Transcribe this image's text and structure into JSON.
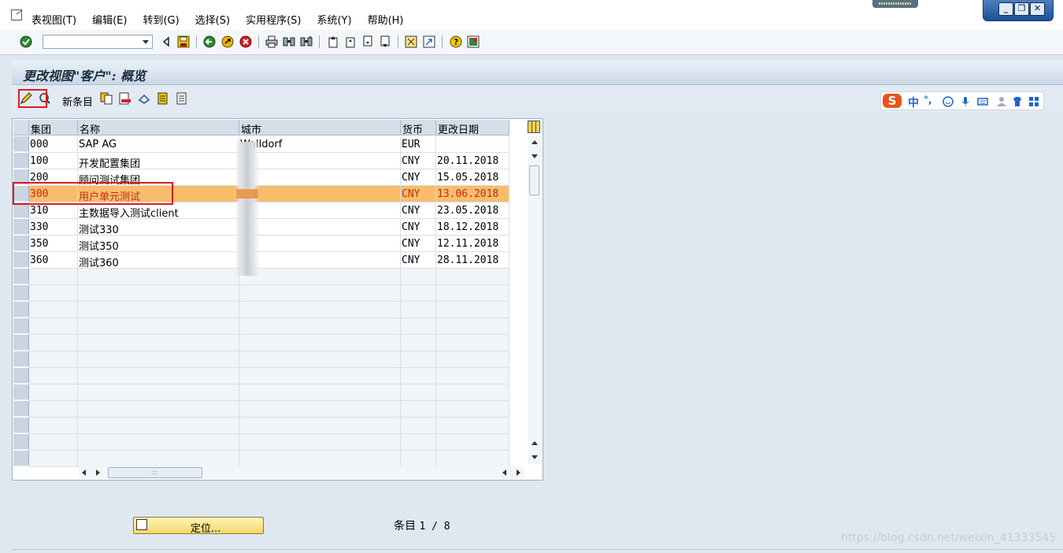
{
  "menu": {
    "items": [
      "表视图(T)",
      "编辑(E)",
      "转到(G)",
      "选择(S)",
      "实用程序(S)",
      "系统(Y)",
      "帮助(H)"
    ]
  },
  "toolbar": {
    "command_value": "",
    "icons": [
      "enter-icon",
      "save-icon",
      "back-icon",
      "exit-icon",
      "cancel-icon",
      "print-icon",
      "find-icon",
      "find-next-icon",
      "first-page-icon",
      "previous-page-icon",
      "next-page-icon",
      "last-page-icon",
      "create-session-icon",
      "shortcut-icon",
      "help-icon",
      "layout-icon"
    ]
  },
  "title": "更改视图\"客户\": 概览",
  "app_toolbar": {
    "new_entries": "新条目",
    "icons": [
      "display-change-icon",
      "other-view-icon",
      "copy-as-icon",
      "delete-icon",
      "undo-icon",
      "select-all-icon",
      "select-block-icon"
    ]
  },
  "ime": {
    "brand": "S",
    "mode": "中",
    "punct": "°,"
  },
  "table": {
    "columns": [
      "集团",
      "名称",
      "城市",
      "货币",
      "更改日期"
    ],
    "rows": [
      {
        "client": "000",
        "name": "SAP AG",
        "city": "Walldorf",
        "currency": "EUR",
        "date": ""
      },
      {
        "client": "100",
        "name": "开发配置集团",
        "city": "",
        "currency": "CNY",
        "date": "20.11.2018"
      },
      {
        "client": "200",
        "name": "顾问测试集团",
        "city": "",
        "currency": "CNY",
        "date": "15.05.2018"
      },
      {
        "client": "300",
        "name": "用户单元测试",
        "city": "",
        "currency": "CNY",
        "date": "13.06.2018"
      },
      {
        "client": "310",
        "name": "主数据导入测试client",
        "city": "",
        "currency": "CNY",
        "date": "23.05.2018"
      },
      {
        "client": "330",
        "name": "测试330",
        "city": "",
        "currency": "CNY",
        "date": "18.12.2018"
      },
      {
        "client": "350",
        "name": "测试350",
        "city": "",
        "currency": "CNY",
        "date": "12.11.2018"
      },
      {
        "client": "360",
        "name": "测试360",
        "city": "",
        "currency": "CNY",
        "date": "28.11.2018"
      }
    ],
    "selected_row": 3,
    "empty_rows": 12
  },
  "bottom": {
    "position_label": "定位...",
    "entries_label": "条目",
    "entries_value": "1 / 8"
  },
  "watermark": "https://blog.csdn.net/weixin_41333545",
  "colors": {
    "highlight_row": "#f8bd6a",
    "highlight_text": "#c8281c",
    "annotation_red": "#e01a1a"
  }
}
